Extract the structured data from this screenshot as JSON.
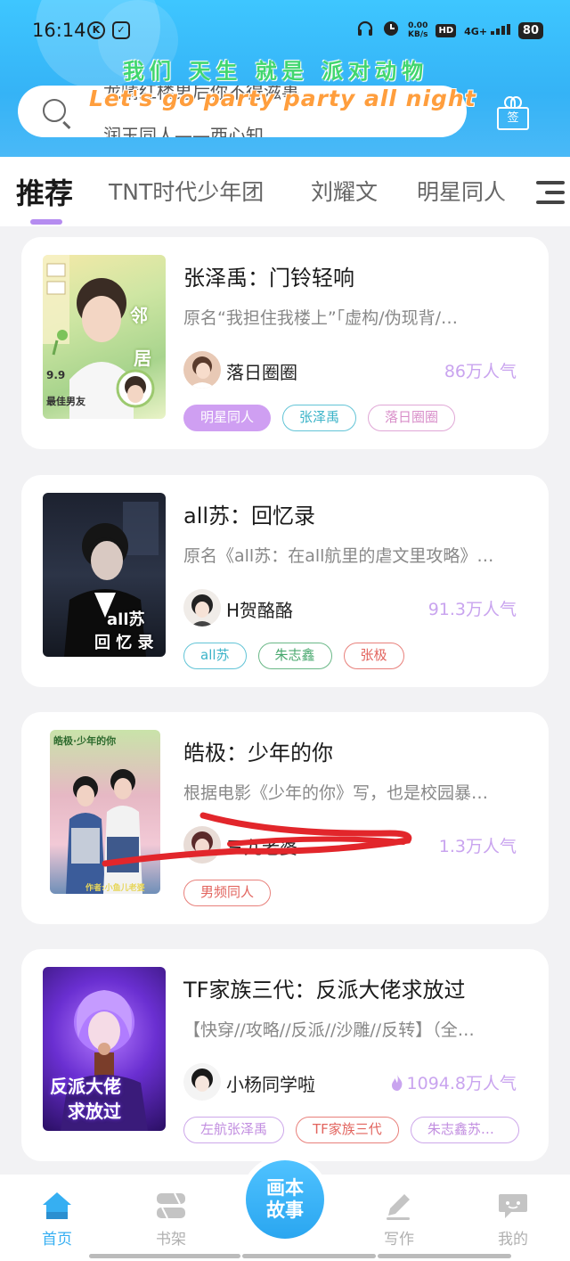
{
  "status_bar": {
    "time": "16:14",
    "left_icons": [
      "K",
      "✓"
    ],
    "net_speed_top": "0.00",
    "net_speed_bottom": "KB/s",
    "hd": "HD",
    "signal": "4G+",
    "battery": "80"
  },
  "header": {
    "slogan": "我们 天生 就是 派对动物",
    "party_text": "Let's go party party all night",
    "search_placeholder_top": "龙晴红楼男后你不得滋事",
    "search_placeholder_bottom": "润玉同人——西心知",
    "checkin_label": "签"
  },
  "tabs": [
    {
      "label": "推荐",
      "active": true
    },
    {
      "label": "TNT时代少年团",
      "active": false
    },
    {
      "label": "刘耀文",
      "active": false
    },
    {
      "label": "明星同人",
      "active": false
    }
  ],
  "stories": [
    {
      "title": "张泽禹：门铃轻响",
      "description": "原名“我担住我楼上”「虚构/伪现背/…",
      "author": "落日圈圈",
      "popularity": "86万人气",
      "hot": false,
      "cover_text": [
        "邻",
        "居",
        "9.9",
        "最佳男友"
      ],
      "tags": [
        {
          "label": "明星同人",
          "style": "filled"
        },
        {
          "label": "张泽禹",
          "style": "teal"
        },
        {
          "label": "落日圈圈",
          "style": "pink"
        }
      ]
    },
    {
      "title": "all苏：回忆录",
      "description": "原名《all苏：在all航里的虐文里攻略》…",
      "author": "H贺酪酪",
      "popularity": "91.3万人气",
      "hot": false,
      "cover_text": [
        "all苏",
        "回 忆 录"
      ],
      "tags": [
        {
          "label": "all苏",
          "style": "teal"
        },
        {
          "label": "朱志鑫",
          "style": "green"
        },
        {
          "label": "张极",
          "style": "red"
        }
      ]
    },
    {
      "title": "皓极：少年的你",
      "description": "根据电影《少年的你》写，也是校园暴…",
      "author": "三九老婆",
      "popularity": "1.3万人气",
      "hot": false,
      "cover_text": [
        "皓极·少年的你",
        "作者:小鱼儿老婆"
      ],
      "tags": [
        {
          "label": "男频同人",
          "style": "red"
        }
      ]
    },
    {
      "title": "TF家族三代：反派大佬求放过",
      "description": "【快穿//攻略//反派//沙雕//反转】（全…",
      "author": "小杨同学啦",
      "popularity": "1094.8万人气",
      "hot": true,
      "cover_text": [
        "反派大佬",
        "求放过"
      ],
      "tags": [
        {
          "label": "左航张泽禹",
          "style": "purple"
        },
        {
          "label": "TF家族三代",
          "style": "red"
        },
        {
          "label": "朱志鑫苏新皓",
          "style": "purple"
        }
      ]
    }
  ],
  "bottom_nav": {
    "items": [
      {
        "label": "首页",
        "icon": "home-icon",
        "active": true
      },
      {
        "label": "书架",
        "icon": "bookshelf-icon",
        "active": false
      },
      {
        "label": "写作",
        "icon": "pencil-icon",
        "active": false
      },
      {
        "label": "我的",
        "icon": "chat-bubble-icon",
        "active": false
      }
    ],
    "center_line1": "画本",
    "center_line2": "故事"
  },
  "colors": {
    "header_blue": "#35b3f6",
    "accent_purple": "#b58cf0",
    "popularity": "#c9a4ef",
    "nav_active": "#36aff2"
  }
}
